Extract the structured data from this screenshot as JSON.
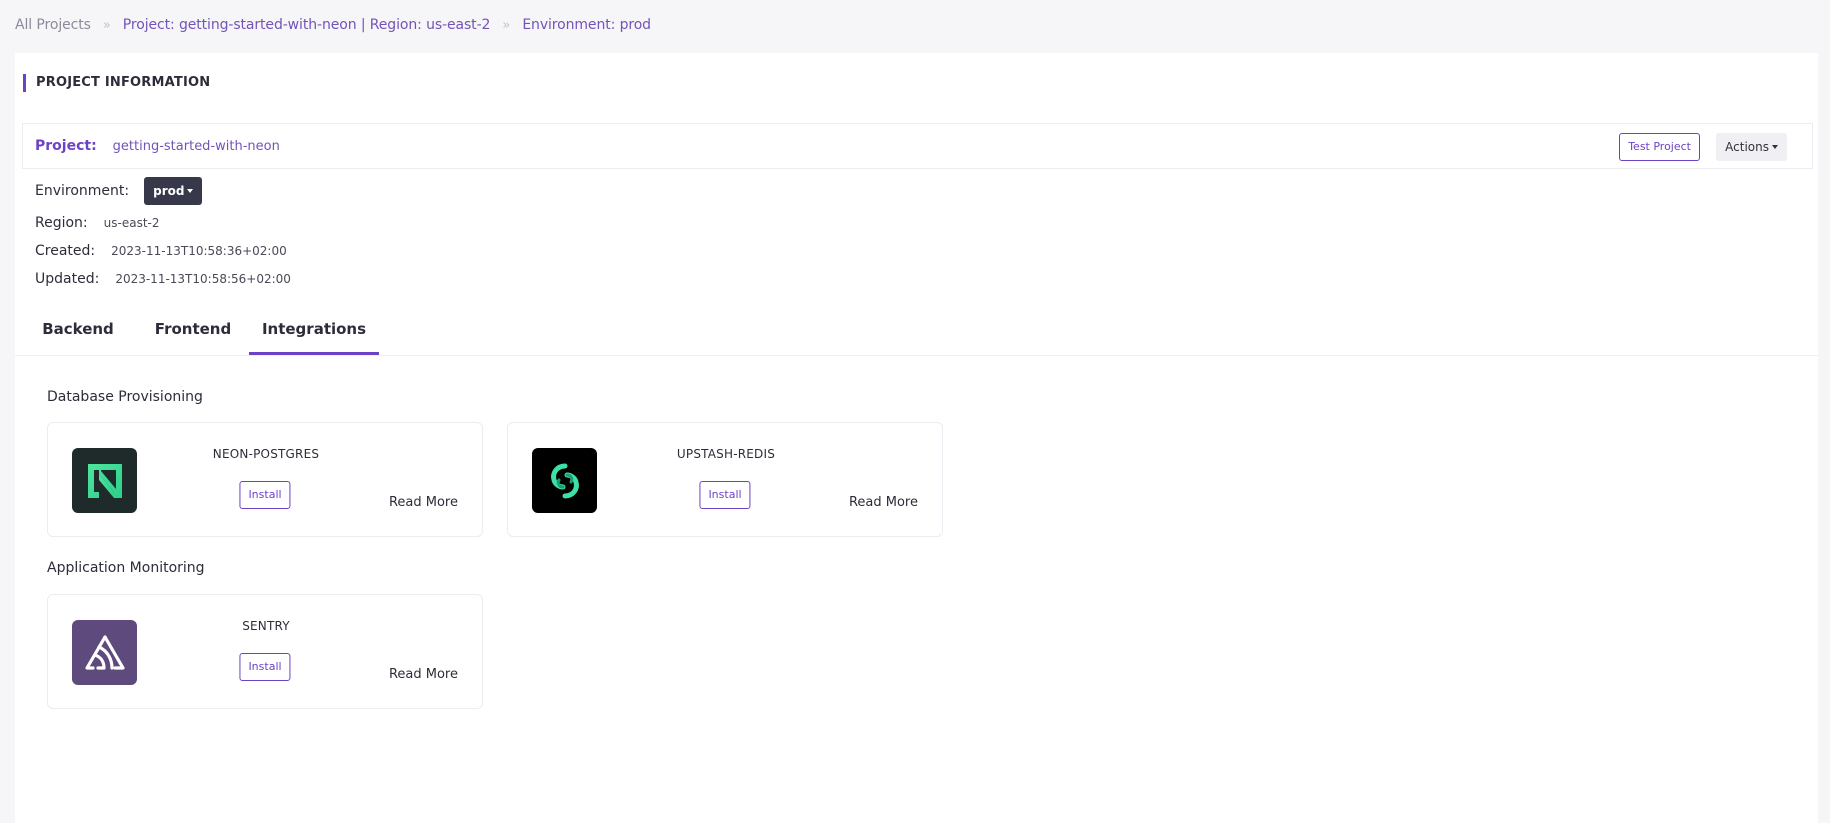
{
  "breadcrumb": {
    "all_projects": "All Projects",
    "project": "Project: getting-started-with-neon | Region: us-east-2",
    "environment": "Environment: prod",
    "separator": "»"
  },
  "section_title": "PROJECT INFORMATION",
  "project": {
    "label": "Project:",
    "name": "getting-started-with-neon",
    "test_button": "Test Project",
    "actions_button": "Actions"
  },
  "info": {
    "environment_label": "Environment:",
    "environment_value": "prod",
    "region_label": "Region:",
    "region_value": "us-east-2",
    "created_label": "Created:",
    "created_value": "2023-11-13T10:58:36+02:00",
    "updated_label": "Updated:",
    "updated_value": "2023-11-13T10:58:56+02:00"
  },
  "tabs": [
    {
      "label": "Backend",
      "active": false
    },
    {
      "label": "Frontend",
      "active": false
    },
    {
      "label": "Integrations",
      "active": true
    }
  ],
  "groups": [
    {
      "title": "Database Provisioning",
      "items": [
        {
          "name": "NEON-POSTGRES",
          "install": "Install",
          "read_more": "Read More",
          "icon": "neon-logo-icon"
        },
        {
          "name": "UPSTASH-REDIS",
          "install": "Install",
          "read_more": "Read More",
          "icon": "upstash-logo-icon"
        }
      ]
    },
    {
      "title": "Application Monitoring",
      "items": [
        {
          "name": "SENTRY",
          "install": "Install",
          "read_more": "Read More",
          "icon": "sentry-logo-icon"
        }
      ]
    }
  ],
  "colors": {
    "accent": "#6d43c6",
    "breadcrumb_active": "#7353b8",
    "env_button": "#37384a",
    "neon_bg": "#1f2a2a",
    "neon_green": "#4ee4a0",
    "upstash_bg": "#000000",
    "upstash_green": "#3ee0a6",
    "sentry_bg": "#5f4a7e"
  }
}
